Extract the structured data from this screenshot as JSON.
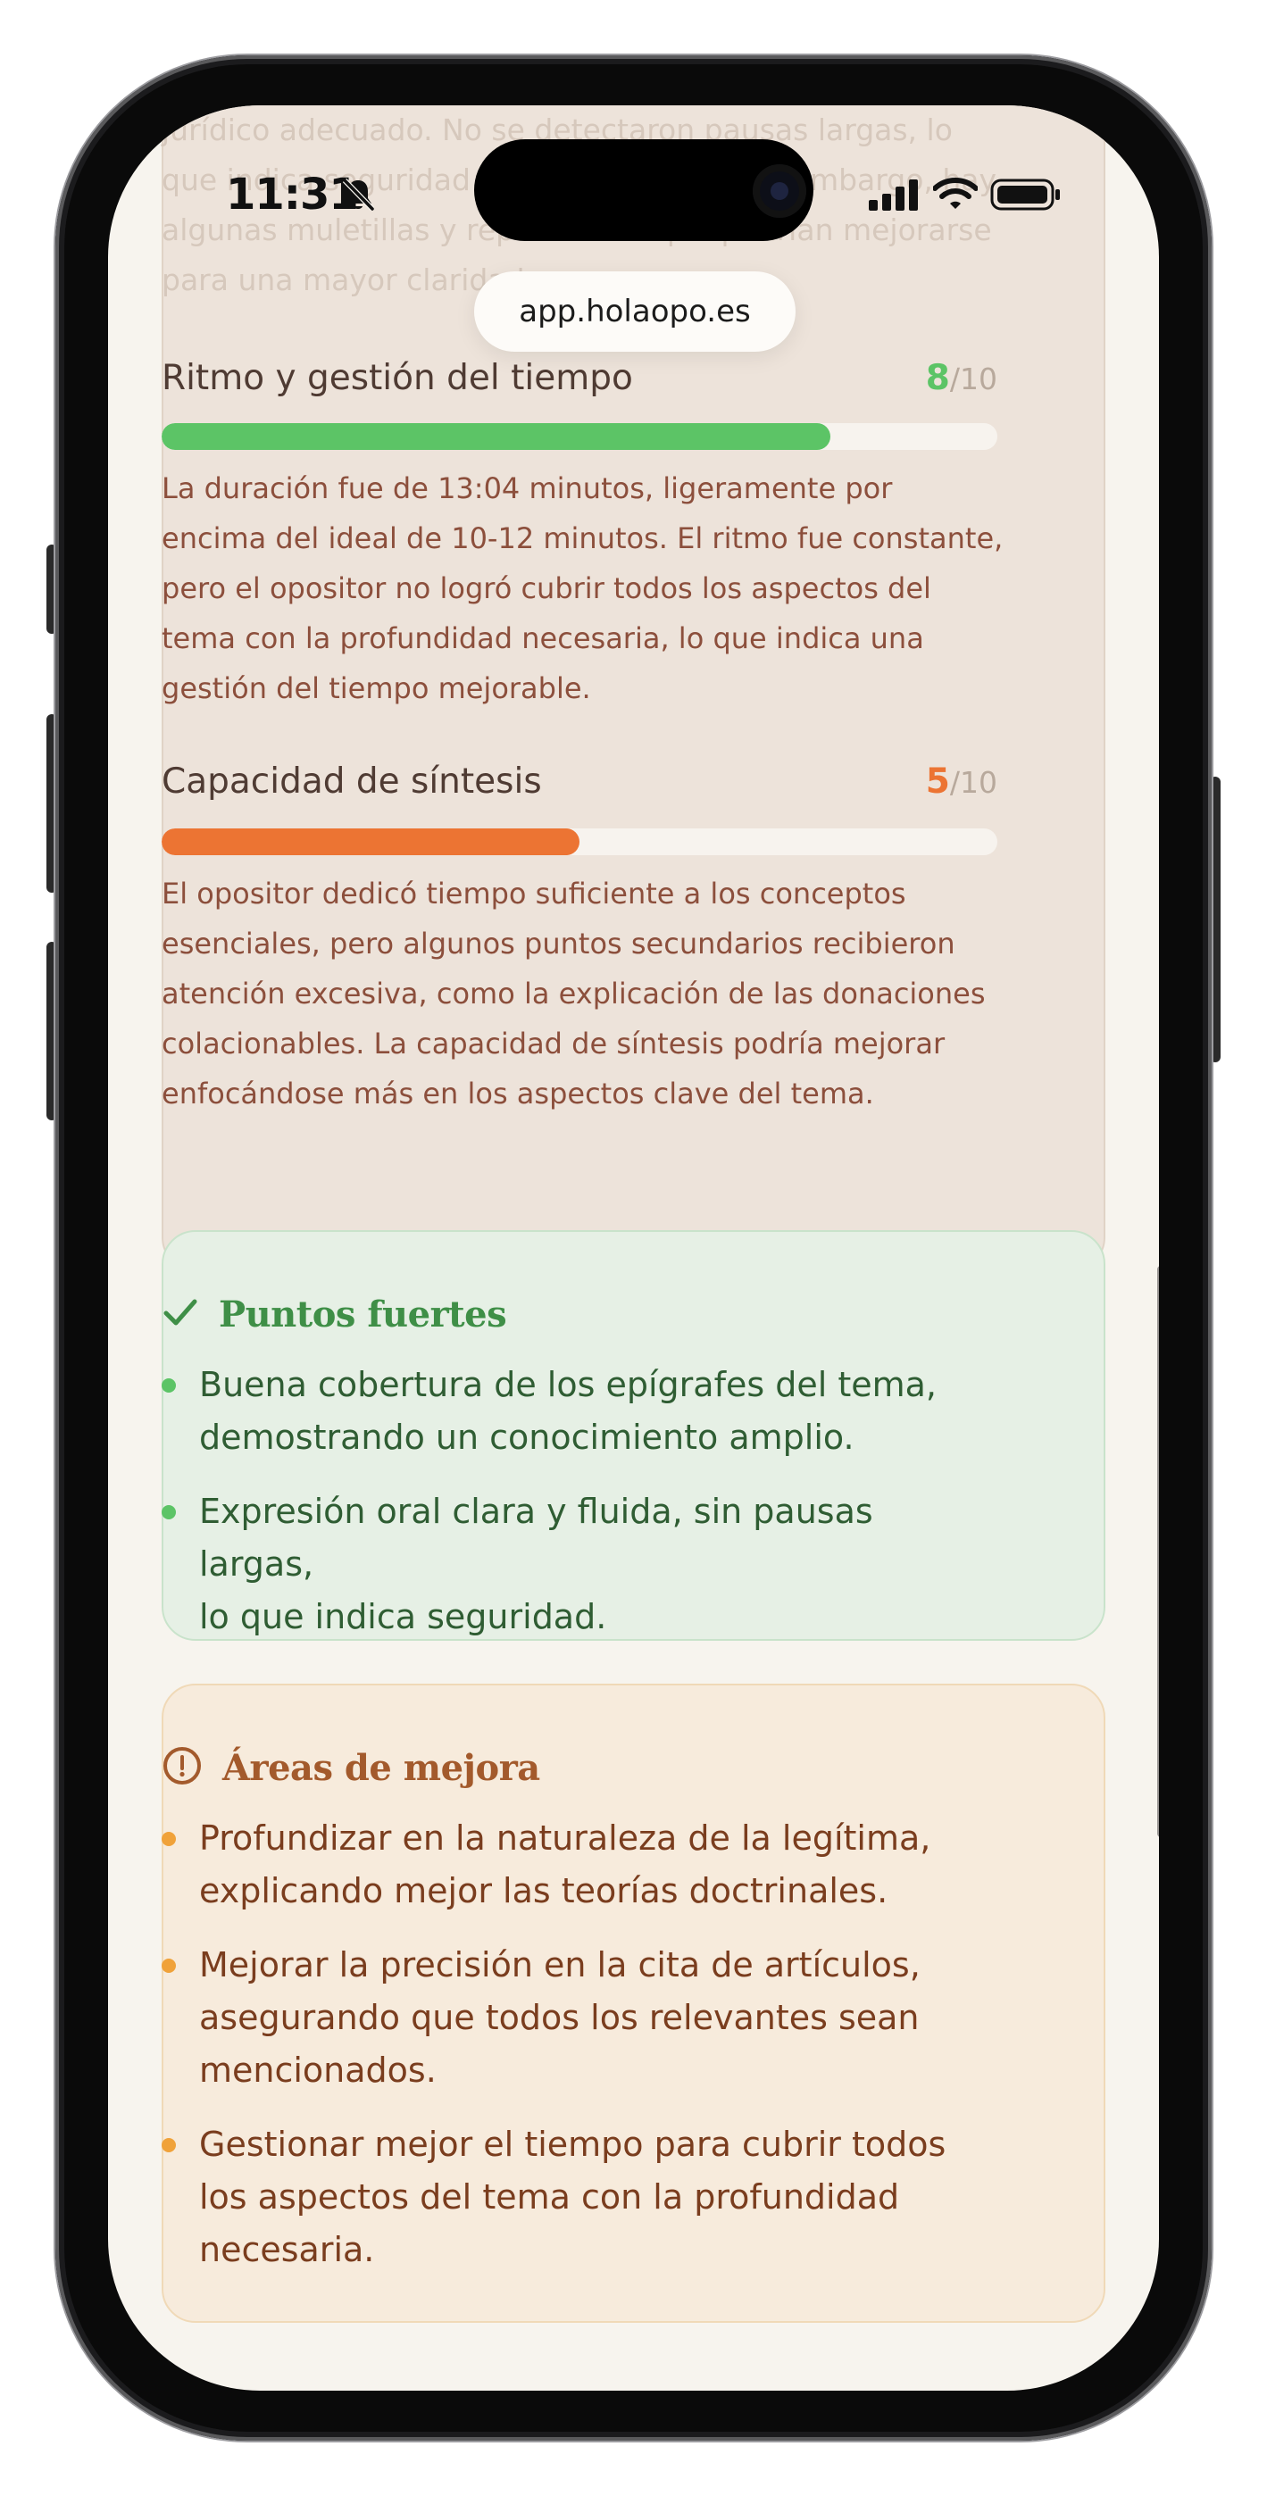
{
  "browser": {
    "url": "app.holaopo.es"
  },
  "status_bar": {
    "time": "11:31"
  },
  "evaluation": {
    "faded_text": [
      "jurídico adecuado. No se detectaron pausas largas, lo",
      "que indica seguridad en la exposición. Sin embargo, hay",
      "algunas muletillas y repeticiones que podrían mejorarse",
      "para una mayor claridad."
    ],
    "metrics": [
      {
        "title": "Ritmo y gestión del tiempo",
        "score": "8",
        "max": "/10",
        "value": 0.8,
        "color": "#5cc466",
        "desc": [
          "La duración fue de 13:04 minutos, ligeramente por",
          "encima del ideal de 10-12 minutos. El ritmo fue constante,",
          "pero el opositor no logró cubrir todos los aspectos del",
          "tema con la profundidad necesaria, lo que indica una",
          "gestión del tiempo mejorable."
        ]
      },
      {
        "title": "Capacidad de síntesis",
        "score": "5",
        "max": "/10",
        "value": 0.5,
        "color": "#ec7433",
        "desc": [
          "El opositor dedicó tiempo suficiente a los conceptos",
          "esenciales, pero algunos puntos secundarios recibieron",
          "atención excesiva, como la explicación de las donaciones",
          "colacionables. La capacidad de síntesis podría mejorar",
          "enfocándose más en los aspectos clave del tema."
        ]
      }
    ]
  },
  "strengths": {
    "title": "Puntos fuertes",
    "icon": "check-icon",
    "color": "#3f8f47",
    "items": [
      [
        "Buena cobertura de los epígrafes del tema,",
        "demostrando un conocimiento amplio."
      ],
      [
        "Expresión oral clara y fluida, sin pausas largas,",
        "lo que indica seguridad."
      ]
    ]
  },
  "improvements": {
    "title": "Áreas de mejora",
    "icon": "alert-circle-icon",
    "color": "#a35a2c",
    "items": [
      [
        "Profundizar en la naturaleza de la legítima,",
        "explicando mejor las teorías doctrinales."
      ],
      [
        "Mejorar la precisión en la cita de artículos,",
        "asegurando que todos los relevantes sean",
        "mencionados."
      ],
      [
        "Gestionar mejor el tiempo para cubrir todos",
        "los aspectos del tema con la profundidad",
        "necesaria."
      ]
    ]
  }
}
